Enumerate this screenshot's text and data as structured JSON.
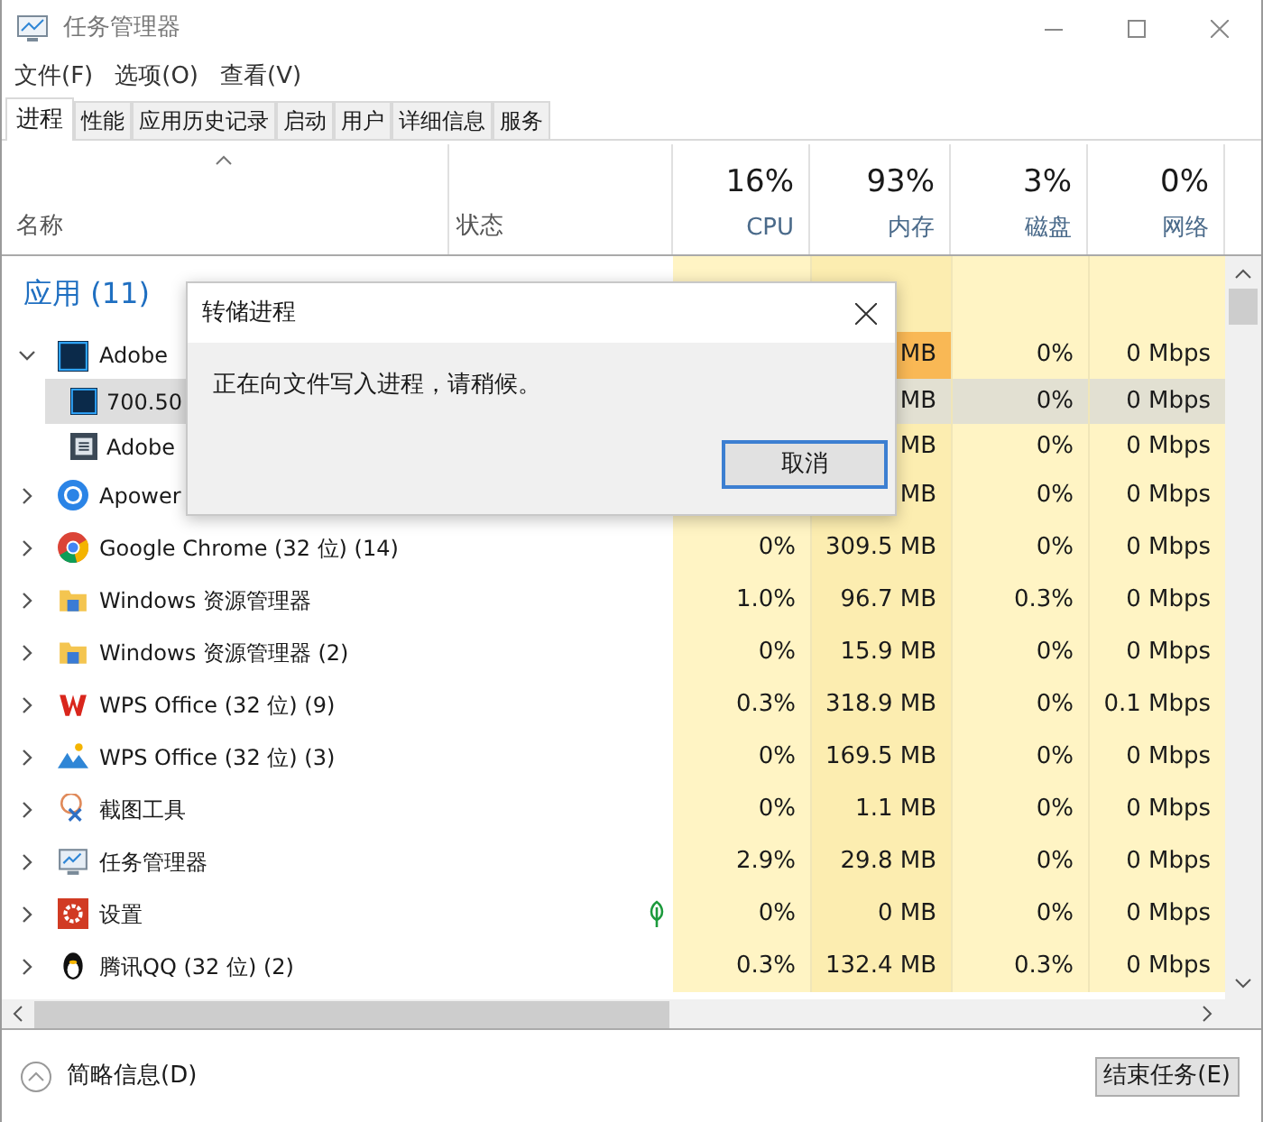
{
  "window": {
    "title": "任务管理器"
  },
  "menu": [
    "文件(F)",
    "选项(O)",
    "查看(V)"
  ],
  "tabs": [
    {
      "label": "进程",
      "selected": true
    },
    {
      "label": "性能",
      "selected": false
    },
    {
      "label": "应用历史记录",
      "selected": false
    },
    {
      "label": "启动",
      "selected": false
    },
    {
      "label": "用户",
      "selected": false
    },
    {
      "label": "详细信息",
      "selected": false
    },
    {
      "label": "服务",
      "selected": false
    }
  ],
  "columns": [
    {
      "label": "名称"
    },
    {
      "label": "状态"
    },
    {
      "value": "16%",
      "label": "CPU"
    },
    {
      "value": "93%",
      "label": "内存"
    },
    {
      "value": "3%",
      "label": "磁盘"
    },
    {
      "value": "0%",
      "label": "网络"
    }
  ],
  "group": {
    "label": "应用 (11)"
  },
  "rows": [
    {
      "name": "Adobe",
      "expanded": true,
      "eco": false,
      "mem_hot": true,
      "memory": "MB",
      "disk": "0%",
      "network": "0 Mbps",
      "children": [
        {
          "name": "700.50",
          "selected": true,
          "memory": "MB",
          "disk": "0%",
          "network": "0 Mbps"
        },
        {
          "name": "Adobe",
          "selected": false,
          "memory": "MB",
          "disk": "0%",
          "network": "0 Mbps"
        }
      ]
    },
    {
      "name": "Apower",
      "expanded": false,
      "eco": false,
      "mem_hot": false,
      "memory": "MB",
      "disk": "0%",
      "network": "0 Mbps"
    },
    {
      "name": "Google Chrome (32 位) (14)",
      "expanded": false,
      "eco": false,
      "mem_hot": false,
      "cpu": "0%",
      "memory": "309.5 MB",
      "disk": "0%",
      "network": "0 Mbps"
    },
    {
      "name": "Windows 资源管理器",
      "expanded": false,
      "eco": false,
      "mem_hot": false,
      "cpu": "1.0%",
      "memory": "96.7 MB",
      "disk": "0.3%",
      "network": "0 Mbps"
    },
    {
      "name": "Windows 资源管理器 (2)",
      "expanded": false,
      "eco": false,
      "mem_hot": false,
      "cpu": "0%",
      "memory": "15.9 MB",
      "disk": "0%",
      "network": "0 Mbps"
    },
    {
      "name": "WPS Office (32 位) (9)",
      "expanded": false,
      "eco": false,
      "mem_hot": false,
      "cpu": "0.3%",
      "memory": "318.9 MB",
      "disk": "0%",
      "network": "0.1 Mbps"
    },
    {
      "name": "WPS Office (32 位) (3)",
      "expanded": false,
      "eco": false,
      "mem_hot": false,
      "cpu": "0%",
      "memory": "169.5 MB",
      "disk": "0%",
      "network": "0 Mbps"
    },
    {
      "name": "截图工具",
      "expanded": false,
      "eco": false,
      "mem_hot": false,
      "cpu": "0%",
      "memory": "1.1 MB",
      "disk": "0%",
      "network": "0 Mbps"
    },
    {
      "name": "任务管理器",
      "expanded": false,
      "eco": false,
      "mem_hot": false,
      "cpu": "2.9%",
      "memory": "29.8 MB",
      "disk": "0%",
      "network": "0 Mbps"
    },
    {
      "name": "设置",
      "expanded": false,
      "eco": true,
      "mem_hot": false,
      "cpu": "0%",
      "memory": "0 MB",
      "disk": "0%",
      "network": "0 Mbps"
    },
    {
      "name": "腾讯QQ (32 位) (2)",
      "expanded": false,
      "eco": false,
      "mem_hot": false,
      "cpu": "0.3%",
      "memory": "132.4 MB",
      "disk": "0.3%",
      "network": "0 Mbps"
    }
  ],
  "dialog": {
    "title": "转储进程",
    "message": "正在向文件写入进程，请稍候。",
    "button": "取消"
  },
  "footer": {
    "link": "简略信息(D)",
    "button": "结束任务(E)"
  }
}
